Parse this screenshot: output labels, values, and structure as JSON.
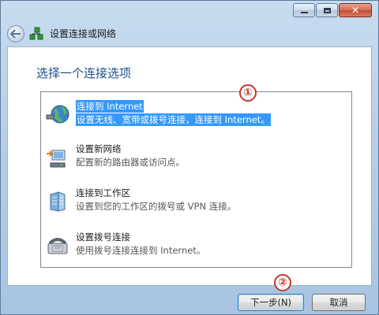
{
  "window": {
    "title": "设置连接或网络"
  },
  "content": {
    "prompt": "选择一个连接选项",
    "options": [
      {
        "title": "连接到 Internet",
        "description": "设置无线、宽带或拨号连接，连接到 Internet。",
        "icon": "globe-network-icon",
        "selected": true
      },
      {
        "title": "设置新网络",
        "description": "配置新的路由器或访问点。",
        "icon": "new-network-router-icon",
        "selected": false
      },
      {
        "title": "连接到工作区",
        "description": "设置到您的工作区的拨号或 VPN 连接。",
        "icon": "workplace-building-icon",
        "selected": false
      },
      {
        "title": "设置拨号连接",
        "description": "使用拨号连接连接到 Internet。",
        "icon": "dialup-phone-icon",
        "selected": false
      }
    ]
  },
  "annotations": [
    "①",
    "②"
  ],
  "buttons": {
    "next": "下一步(N)",
    "cancel": "取消"
  },
  "colors": {
    "selection": "#3399ff",
    "prompt_text": "#1b4f8c",
    "annotation": "#c0392b"
  }
}
